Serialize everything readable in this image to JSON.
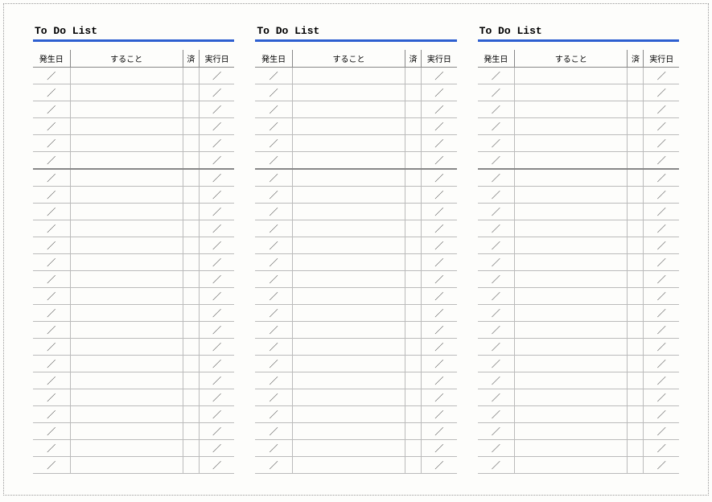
{
  "title": "To Do List",
  "columns": {
    "date": "発生日",
    "task": "すること",
    "done": "済",
    "exec": "実行日"
  },
  "date_placeholder": "／",
  "panel_count": 3,
  "row_count": 24
}
